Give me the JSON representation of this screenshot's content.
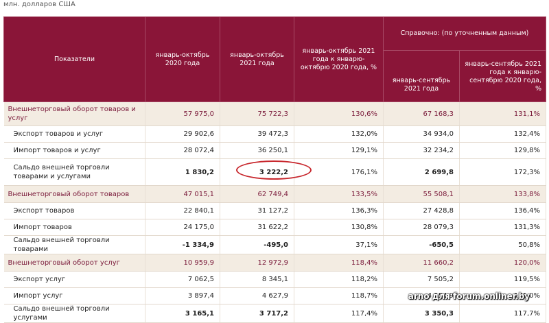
{
  "unit_note": "млн. долларов США",
  "header": {
    "indicators": "Показатели",
    "col1": "январь-октябрь 2020 года",
    "col2": "январь-октябрь 2021 года",
    "col3": "январь-октябрь 2021 года к январю-октябрю 2020 года, %",
    "ref_group": "Справочно: (по уточненным данным)",
    "col4": "январь-сентябрь 2021 года",
    "col5": "январь-сентябрь 2021 года к январю-сентябрю 2020 года, %"
  },
  "rows": [
    {
      "name": "Внешнеторговый оборот товаров и услуг",
      "v1": "57 975,0",
      "v2": "75 722,3",
      "v3": "130,6%",
      "v4": "67 168,3",
      "v5": "131,1%"
    },
    {
      "name": "Экспорт товаров и услуг",
      "v1": "29 902,6",
      "v2": "39 472,3",
      "v3": "132,0%",
      "v4": "34 934,0",
      "v5": "132,4%"
    },
    {
      "name": "Импорт товаров и услуг",
      "v1": "28 072,4",
      "v2": "36 250,1",
      "v3": "129,1%",
      "v4": "32 234,2",
      "v5": "129,8%"
    },
    {
      "name": "Сальдо внешней торговли товарами и услугами",
      "v1": "1 830,2",
      "v2": "3 222,2",
      "v3": "176,1%",
      "v4": "2 699,8",
      "v5": "172,3%"
    },
    {
      "name": "Внешнеторговый оборот товаров",
      "v1": "47 015,1",
      "v2": "62 749,4",
      "v3": "133,5%",
      "v4": "55 508,1",
      "v5": "133,8%"
    },
    {
      "name": "Экспорт товаров",
      "v1": "22 840,1",
      "v2": "31 127,2",
      "v3": "136,3%",
      "v4": "27 428,8",
      "v5": "136,4%"
    },
    {
      "name": "Импорт товаров",
      "v1": "24 175,0",
      "v2": "31 622,2",
      "v3": "130,8%",
      "v4": "28 079,3",
      "v5": "131,3%"
    },
    {
      "name": "Сальдо внешней торговли товарами",
      "v1": "-1 334,9",
      "v2": "-495,0",
      "v3": "37,1%",
      "v4": "-650,5",
      "v5": "50,8%"
    },
    {
      "name": "Внешнеторговый оборот услуг",
      "v1": "10 959,9",
      "v2": "12 972,9",
      "v3": "118,4%",
      "v4": "11 660,2",
      "v5": "120,0%"
    },
    {
      "name": "Экспорт услуг",
      "v1": "7 062,5",
      "v2": "8 345,1",
      "v3": "118,2%",
      "v4": "7 505,2",
      "v5": "119,5%"
    },
    {
      "name": "Импорт услуг",
      "v1": "3 897,4",
      "v2": "4 627,9",
      "v3": "118,7%",
      "v4": "4 154,9",
      "v5": "121,0%"
    },
    {
      "name": "Сальдо внешней торговли услугами",
      "v1": "3 165,1",
      "v2": "3 717,2",
      "v3": "117,4%",
      "v4": "3 350,3",
      "v5": "117,7%"
    }
  ],
  "watermark": "arno для forum.onliner.by",
  "colors": {
    "header_bg": "#8a1538",
    "total_row_bg": "#f3ece2",
    "total_row_text": "#7a1a3a",
    "highlight_ellipse": "#c8282e"
  }
}
